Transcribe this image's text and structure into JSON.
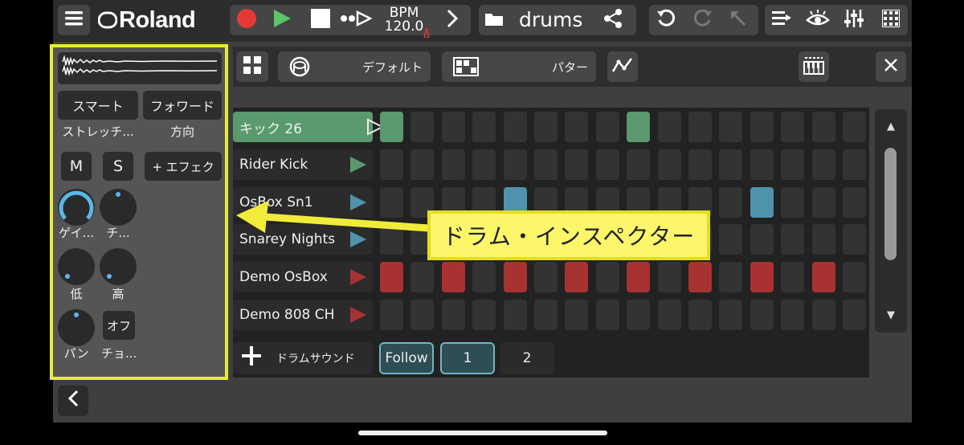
{
  "topbar": {
    "brand": "Roland",
    "bpm_label": "BPM",
    "bpm_value": "120.0",
    "project_name": "drums",
    "colors": {
      "record": "#e53935",
      "play": "#5cc46a"
    },
    "icons": [
      "menu-icon",
      "record-icon",
      "play-icon",
      "stop-icon",
      "loop-icon",
      "metronome-icon",
      "next-icon",
      "folder-icon",
      "share-icon",
      "undo-icon",
      "redo-icon",
      "pointer-icon",
      "tracks-icon",
      "eye-icon",
      "mixer-icon",
      "pads-icon"
    ]
  },
  "toolbar": {
    "kit_label": "デフォルト",
    "pattern_label": "パター",
    "icons": [
      "grid-icon",
      "drum-icon",
      "pattern-icon",
      "automation-icon",
      "piano-icon",
      "close-icon"
    ]
  },
  "inspector": {
    "smart_button": "スマート",
    "stretch_label": "ストレッチ...",
    "forward_button": "フォワード",
    "direction_label": "方向",
    "mute_button": "M",
    "solo_button": "S",
    "add_effect_button": "+ エフェク",
    "gain_label": "ゲイ...",
    "tune_label": "チ...",
    "low_label": "低",
    "high_label": "高",
    "pan_label": "パン",
    "choke_button": "オフ",
    "choke_label": "チョ..."
  },
  "tracks": [
    {
      "name": "キック 26",
      "color": "#5a9a6e",
      "selected": true,
      "steps": [
        1,
        0,
        0,
        0,
        0,
        0,
        0,
        0,
        1,
        0,
        0,
        0,
        0,
        0,
        0,
        0
      ]
    },
    {
      "name": "Rider Kick",
      "color": "#5a9a6e",
      "selected": false,
      "steps": [
        0,
        0,
        0,
        0,
        0,
        0,
        0,
        0,
        0,
        0,
        0,
        0,
        0,
        0,
        0,
        0
      ]
    },
    {
      "name": "OsBox Sn1",
      "color": "#4e93ab",
      "selected": false,
      "steps": [
        0,
        0,
        0,
        0,
        1,
        0,
        0,
        0,
        0,
        0,
        0,
        0,
        1,
        0,
        0,
        0
      ]
    },
    {
      "name": "Snarey Nights",
      "color": "#4e93ab",
      "selected": false,
      "steps": [
        0,
        0,
        0,
        0,
        0,
        0,
        0,
        0,
        0,
        0,
        0,
        0,
        0,
        0,
        0,
        0
      ]
    },
    {
      "name": "Demo OsBox",
      "color": "#a83232",
      "selected": false,
      "steps": [
        1,
        0,
        1,
        0,
        1,
        0,
        1,
        0,
        1,
        0,
        1,
        0,
        1,
        0,
        1,
        0
      ]
    },
    {
      "name": "Demo 808 CH",
      "color": "#a83232",
      "selected": false,
      "steps": [
        0,
        0,
        0,
        0,
        0,
        0,
        0,
        0,
        0,
        0,
        0,
        0,
        0,
        0,
        0,
        0
      ]
    }
  ],
  "bottom": {
    "add_drum_sound": "ドラムサウンド",
    "follow_button": "Follow",
    "page1": "1",
    "page2": "2"
  },
  "scroll": {
    "up": "▲",
    "down": "▼"
  },
  "annotation": {
    "text": "ドラム・インスペクター"
  }
}
